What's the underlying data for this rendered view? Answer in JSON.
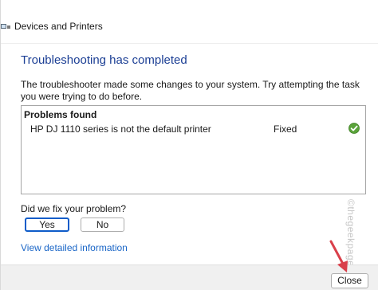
{
  "window": {
    "title": "Devices and Printers"
  },
  "main": {
    "heading": "Troubleshooting has completed",
    "description": "The troubleshooter made some changes to your system. Try attempting the task you were trying to do before."
  },
  "problems": {
    "header": "Problems found",
    "rows": [
      {
        "description": "HP DJ 1110 series is not the default printer",
        "status": "Fixed",
        "icon": "check-circle-icon"
      }
    ]
  },
  "feedback": {
    "question": "Did we fix your problem?",
    "yes_label": "Yes",
    "no_label": "No"
  },
  "links": {
    "details": "View detailed information"
  },
  "footer": {
    "close_label": "Close"
  },
  "watermark": "©thegeekpage.com",
  "colors": {
    "heading": "#1c3f95",
    "link": "#1a66c7",
    "focus_border": "#0f5cc9",
    "check_green": "#5aa33a",
    "arrow": "#d9404b"
  }
}
